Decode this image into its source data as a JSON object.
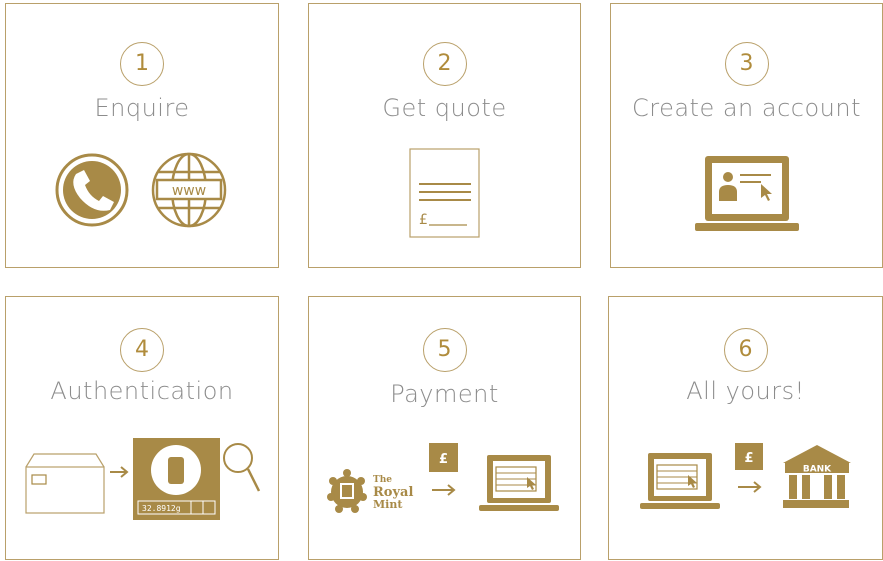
{
  "colors": {
    "gold": "#a88a47",
    "border": "#b9a06a",
    "title_grey": "#8c8c8c"
  },
  "steps": [
    {
      "number": "1",
      "title": "Enquire",
      "icons": [
        "phone-icon",
        "globe-www-icon"
      ],
      "globe_text": "www"
    },
    {
      "number": "2",
      "title": "Get quote",
      "icons": [
        "quote-document-icon"
      ],
      "pound_symbol": "£"
    },
    {
      "number": "3",
      "title": "Create an account",
      "icons": [
        "laptop-user-profile-icon"
      ]
    },
    {
      "number": "4",
      "title": "Authentication",
      "icons": [
        "parcel-icon",
        "arrow-right-icon",
        "scale-icon",
        "magnifier-icon"
      ],
      "scale_reading": "32.8912g"
    },
    {
      "number": "5",
      "title": "Payment",
      "icons": [
        "royal-mint-logo",
        "pound-badge-icon",
        "arrow-right-icon",
        "laptop-form-icon"
      ],
      "pound_symbol": "£",
      "logo_lines": [
        "The",
        "Royal",
        "Mint"
      ]
    },
    {
      "number": "6",
      "title": "All yours!",
      "icons": [
        "laptop-form-icon",
        "pound-badge-icon",
        "arrow-right-icon",
        "bank-icon"
      ],
      "pound_symbol": "£",
      "bank_text": "BANK"
    }
  ]
}
